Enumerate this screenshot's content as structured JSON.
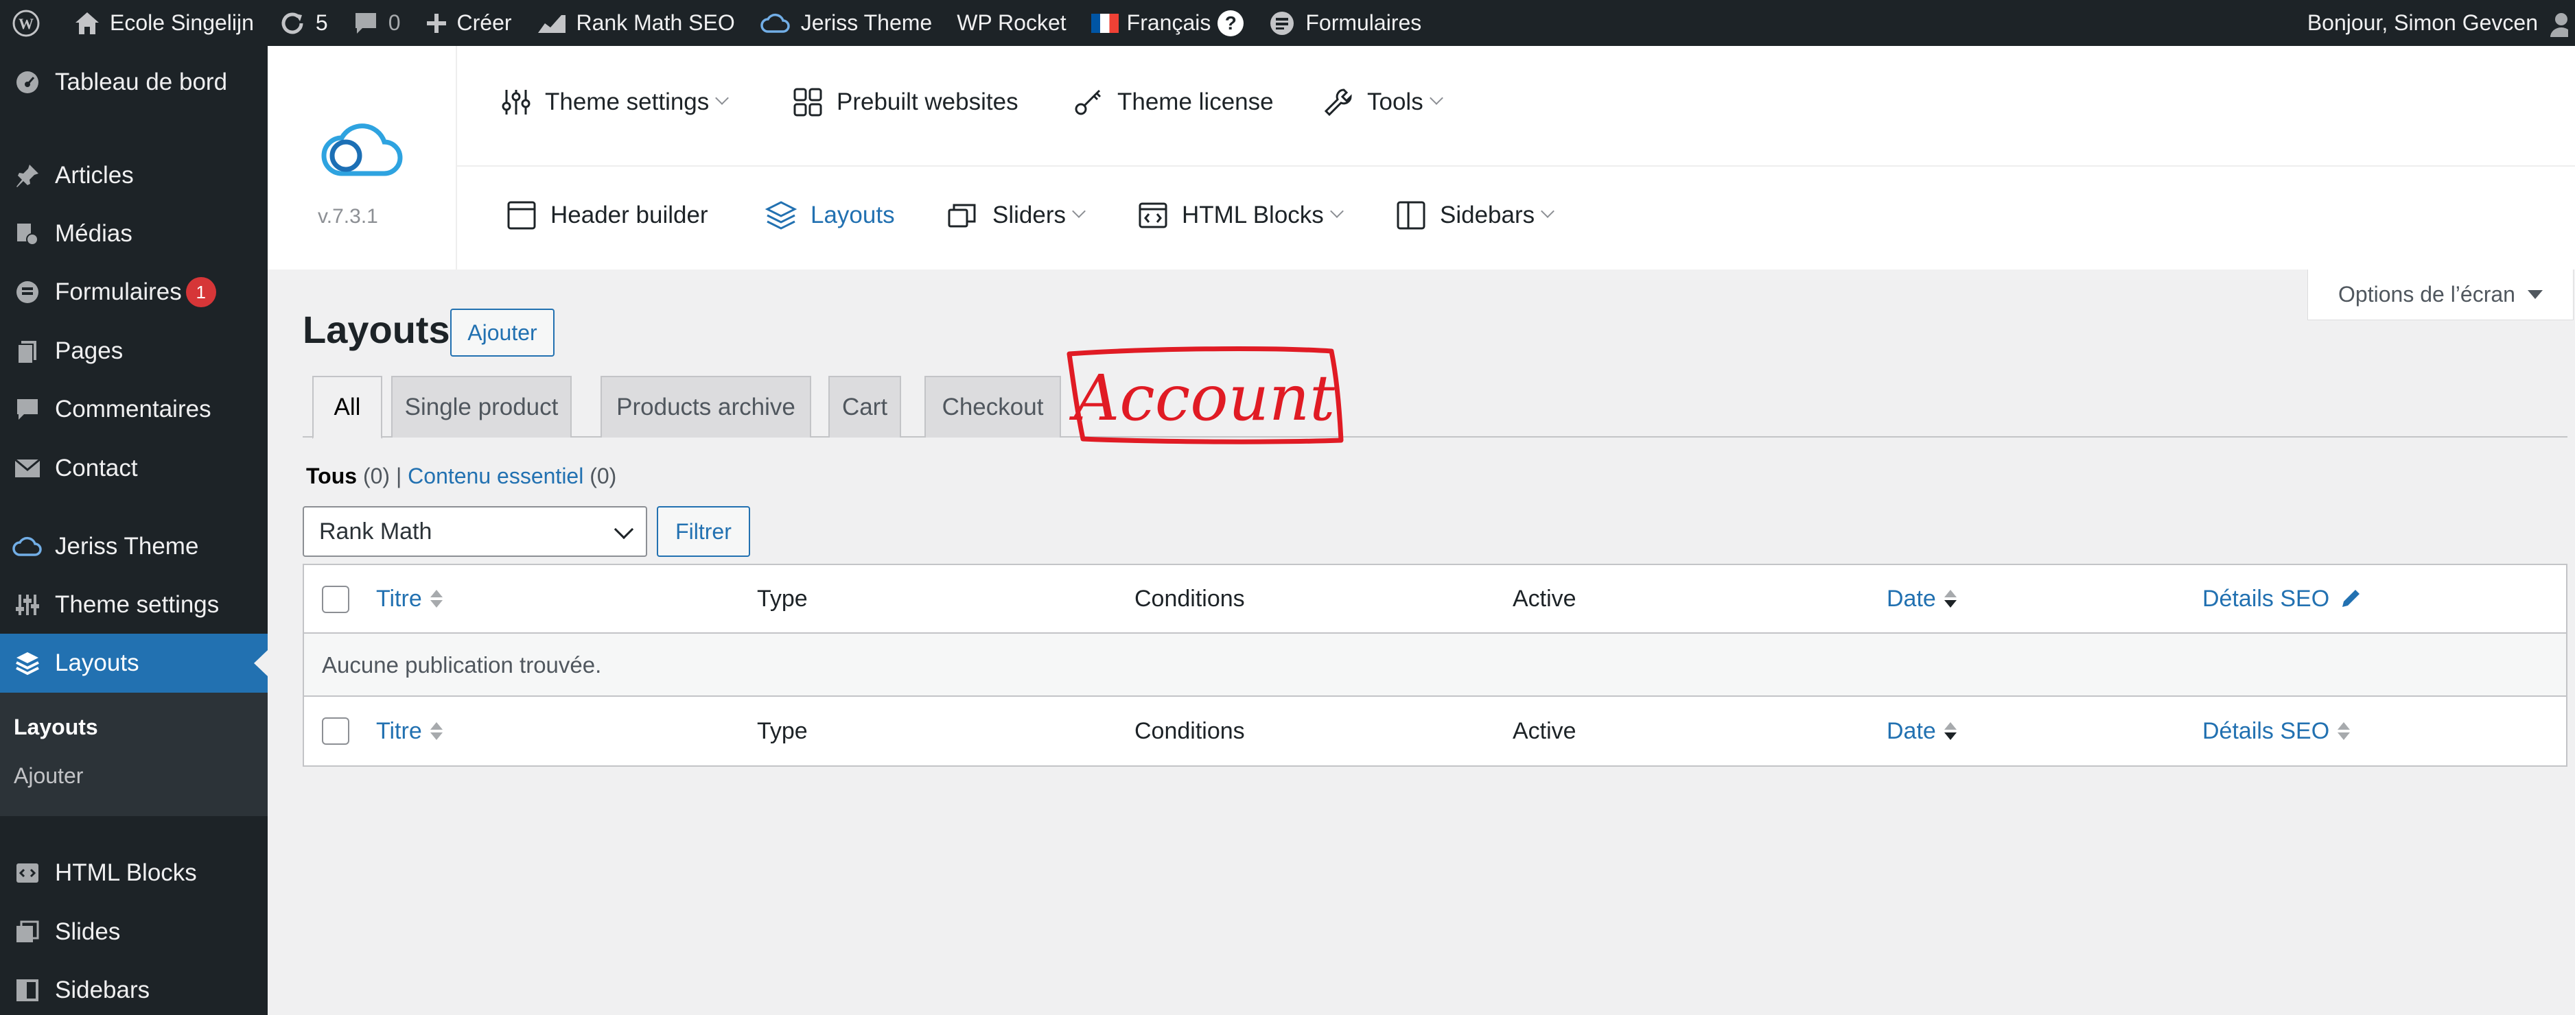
{
  "adminbar": {
    "site_name": "Ecole Singelijn",
    "updates_count": "5",
    "comments_count": "0",
    "new_label": "Créer",
    "rankmath_label": "Rank Math SEO",
    "jeriss_label": "Jeriss Theme",
    "wprocket_label": "WP Rocket",
    "language_label": "Français",
    "help_label": "?",
    "forms_label": "Formulaires",
    "greeting": "Bonjour, Simon Gevcen"
  },
  "sidebar": {
    "items": [
      {
        "label": "Tableau de bord",
        "icon": "dashboard-icon"
      },
      {
        "label": "Articles",
        "icon": "pin-icon"
      },
      {
        "label": "Médias",
        "icon": "media-icon"
      },
      {
        "label": "Formulaires",
        "icon": "forms-icon",
        "badge": "1"
      },
      {
        "label": "Pages",
        "icon": "pages-icon"
      },
      {
        "label": "Commentaires",
        "icon": "comments-icon"
      },
      {
        "label": "Contact",
        "icon": "mail-icon"
      },
      {
        "label": "Jeriss Theme",
        "icon": "cloud-icon"
      },
      {
        "label": "Theme settings",
        "icon": "sliders-icon"
      },
      {
        "label": "Layouts",
        "icon": "layers-icon"
      },
      {
        "label": "HTML Blocks",
        "icon": "code-block-icon"
      },
      {
        "label": "Slides",
        "icon": "slides-icon"
      },
      {
        "label": "Sidebars",
        "icon": "sidebar-icon"
      }
    ],
    "submenu": [
      {
        "label": "Layouts"
      },
      {
        "label": "Ajouter"
      }
    ]
  },
  "themenav": {
    "version": "v.7.3.1",
    "row1": [
      {
        "label": "Theme settings"
      },
      {
        "label": "Prebuilt websites"
      },
      {
        "label": "Theme license"
      },
      {
        "label": "Tools"
      }
    ],
    "row2": [
      {
        "label": "Header builder"
      },
      {
        "label": "Layouts"
      },
      {
        "label": "Sliders"
      },
      {
        "label": "HTML Blocks"
      },
      {
        "label": "Sidebars"
      }
    ]
  },
  "screen_options": "Options de l’écran",
  "page": {
    "title": "Layouts",
    "add_button": "Ajouter",
    "tabs": [
      "All",
      "Single product",
      "Products archive",
      "Cart",
      "Checkout"
    ],
    "annotation_text": "Account",
    "annotation_color": "#e01b24",
    "views": {
      "all_label": "Tous",
      "all_count": "(0)",
      "separator": "|",
      "essential_label": "Contenu essentiel",
      "essential_count": "(0)"
    },
    "filter_select": "Rank Math",
    "filter_button": "Filtrer",
    "table": {
      "columns": [
        "Titre",
        "Type",
        "Conditions",
        "Active",
        "Date",
        "Détails SEO"
      ],
      "empty_message": "Aucune publication trouvée."
    }
  },
  "colors": {
    "admin_bg": "#1d2327",
    "accent": "#2271b1",
    "badge": "#d63638"
  }
}
